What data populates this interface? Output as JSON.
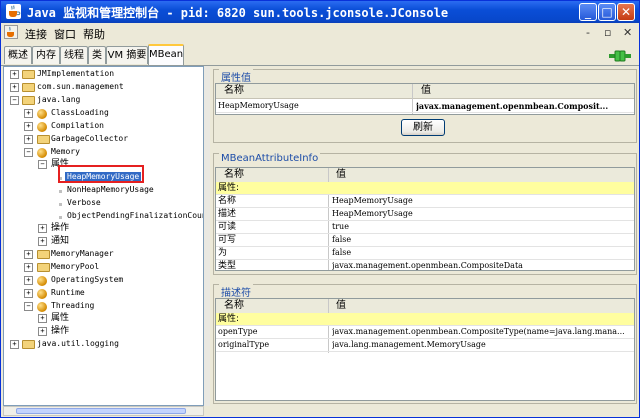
{
  "window": {
    "title": "Java 监视和管理控制台 - pid: 6820 sun.tools.jconsole.JConsole"
  },
  "menu": {
    "items": [
      "连接",
      "窗口",
      "帮助"
    ],
    "right_controls": [
      "-",
      "▫",
      "✕"
    ]
  },
  "tabs": [
    "概述",
    "内存",
    "线程",
    "类",
    "VM 摘要",
    "MBean"
  ],
  "active_tab": "MBean",
  "tree": {
    "nodes": [
      {
        "label": "JMImplementation"
      },
      {
        "label": "com.sun.management"
      },
      {
        "label": "java.lang"
      },
      {
        "label": "ClassLoading"
      },
      {
        "label": "Compilation"
      },
      {
        "label": "GarbageCollector"
      },
      {
        "label": "Memory"
      },
      {
        "label": "属性"
      },
      {
        "label": "HeapMemoryUsage"
      },
      {
        "label": "NonHeapMemoryUsage"
      },
      {
        "label": "Verbose"
      },
      {
        "label": "ObjectPendingFinalizationCoun"
      },
      {
        "label": "操作"
      },
      {
        "label": "通知"
      },
      {
        "label": "MemoryManager"
      },
      {
        "label": "MemoryPool"
      },
      {
        "label": "OperatingSystem"
      },
      {
        "label": "Runtime"
      },
      {
        "label": "Threading"
      },
      {
        "label": "属性"
      },
      {
        "label": "操作"
      },
      {
        "label": "java.util.logging"
      }
    ]
  },
  "attr_value_panel": {
    "title": "属性值",
    "col_name": "名称",
    "col_value": "值",
    "rows": [
      {
        "name": "HeapMemoryUsage",
        "value": "javax.management.openmbean.Composit..."
      }
    ],
    "refresh_label": "刷新"
  },
  "attr_info_panel": {
    "title": "MBeanAttributeInfo",
    "col_name": "名称",
    "col_value": "值",
    "rows": [
      {
        "name": "属性:",
        "value": "",
        "highlight": true
      },
      {
        "name": "名称",
        "value": "HeapMemoryUsage"
      },
      {
        "name": "描述",
        "value": "HeapMemoryUsage"
      },
      {
        "name": "可读",
        "value": "true"
      },
      {
        "name": "可写",
        "value": "false"
      },
      {
        "name": "为",
        "value": "false"
      },
      {
        "name": "类型",
        "value": "javax.management.openmbean.CompositeData"
      }
    ]
  },
  "descriptor_panel": {
    "title": "描述符",
    "col_name": "名称",
    "col_value": "值",
    "rows": [
      {
        "name": "属性:",
        "value": "",
        "highlight": true
      },
      {
        "name": "openType",
        "value": "javax.management.openmbean.CompositeType(name=java.lang.mana..."
      },
      {
        "name": "originalType",
        "value": "java.lang.management.MemoryUsage"
      }
    ]
  },
  "colors": {
    "titlebar": "#0a4ed7",
    "selection": "#316ac5",
    "highlight_row": "#fffe9f",
    "annotation_box": "#e52020",
    "group_title": "#1c4ca8"
  }
}
